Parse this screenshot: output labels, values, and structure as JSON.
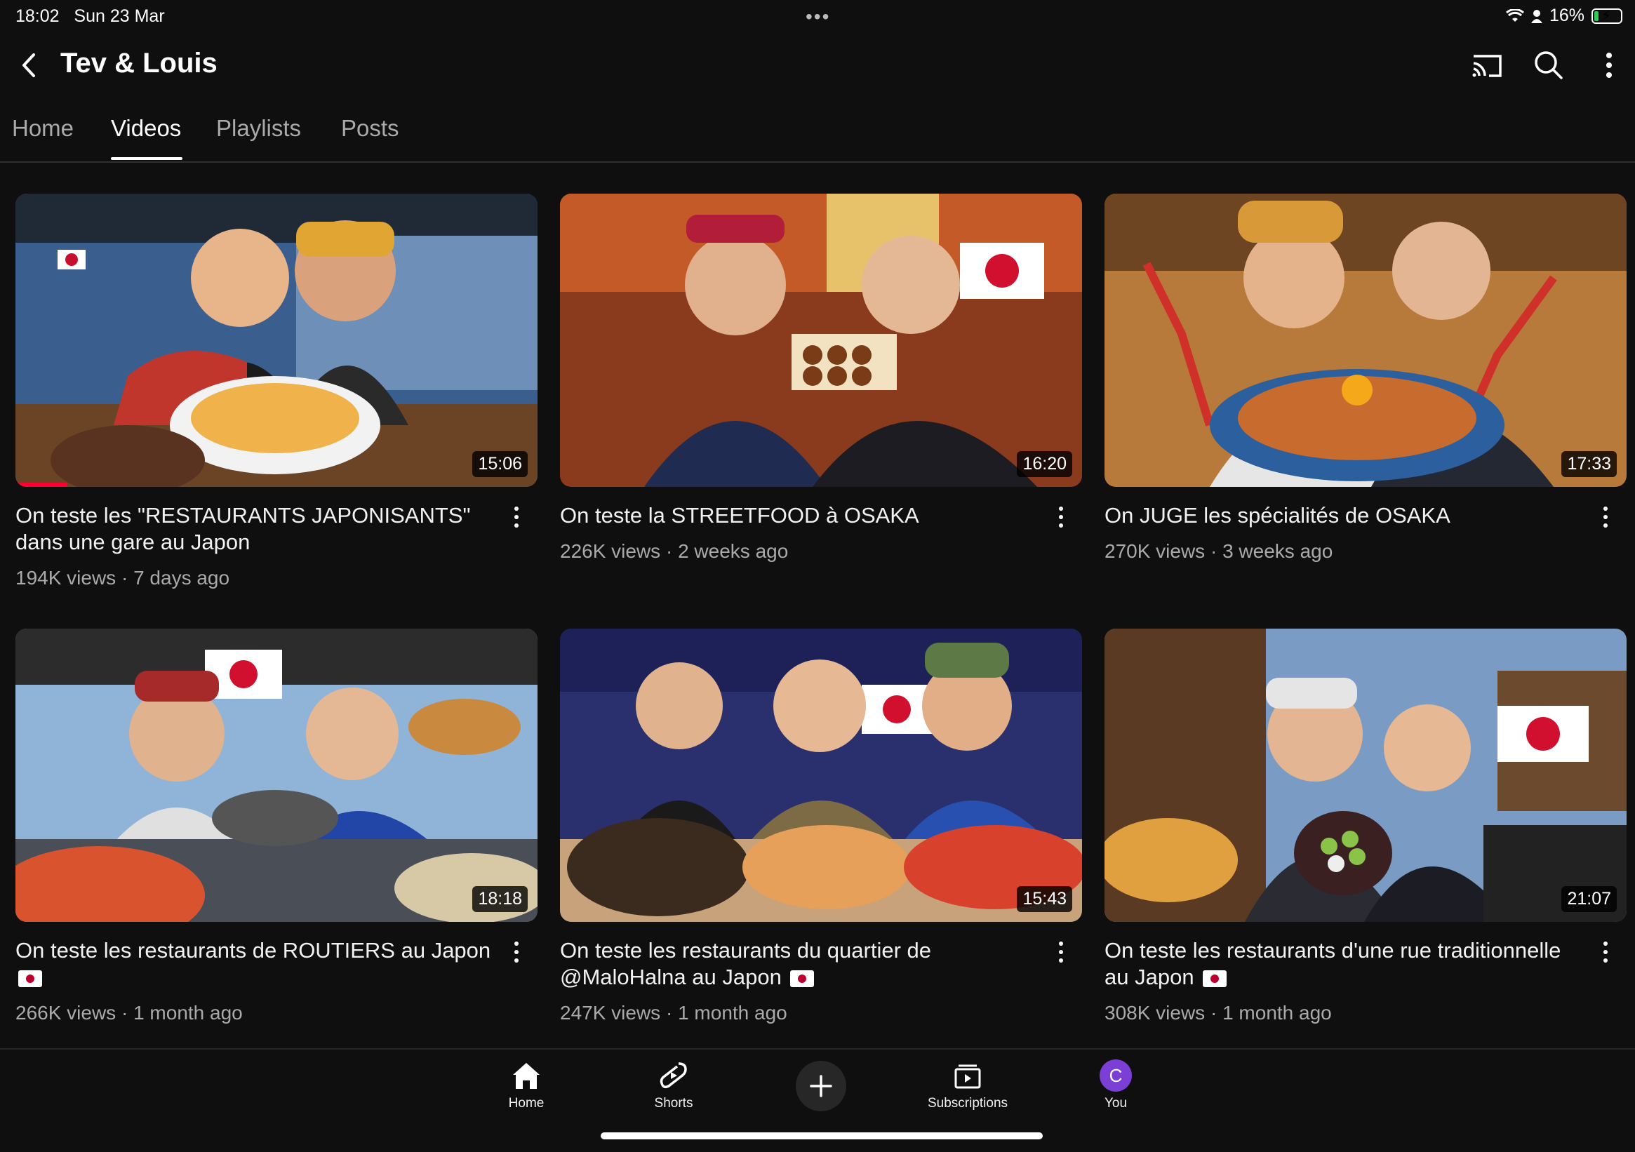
{
  "status": {
    "time": "18:02",
    "date": "Sun 23 Mar",
    "battery": "16%",
    "battery_level": 0.16
  },
  "header": {
    "title": "Tev & Louis",
    "icons": [
      "cast-icon",
      "search-icon",
      "more-vert-icon"
    ]
  },
  "tabs": [
    {
      "label": "Home",
      "active": false
    },
    {
      "label": "Videos",
      "active": true
    },
    {
      "label": "Playlists",
      "active": false
    },
    {
      "label": "Posts",
      "active": false
    }
  ],
  "videos": [
    {
      "title": "On teste les \"RESTAURANTS JAPONISANTS\" dans une gare au Japon",
      "views": "194K views · 7 days ago",
      "duration": "15:06",
      "watched_fraction": 0.1
    },
    {
      "title": "On teste la STREETFOOD à OSAKA",
      "views": "226K views · 2 weeks ago",
      "duration": "16:20"
    },
    {
      "title": "On JUGE les spécialités de OSAKA",
      "views": "270K views · 3 weeks ago",
      "duration": "17:33"
    },
    {
      "title": "On teste les restaurants de ROUTIERS au Japon",
      "views": "266K views · 1 month ago",
      "duration": "18:18",
      "flag": true
    },
    {
      "title": "On teste les restaurants du quartier de @MaloHalna au Japon",
      "views": "247K views · 1 month ago",
      "duration": "15:43",
      "flag": true
    },
    {
      "title": "On teste les restaurants d'une rue traditionnelle au Japon",
      "views": "308K views · 1 month ago",
      "duration": "21:07",
      "flag": true
    }
  ],
  "bottom_nav": [
    {
      "label": "Home",
      "icon": "home-icon"
    },
    {
      "label": "Shorts",
      "icon": "shorts-icon"
    },
    {
      "label": "",
      "icon": "create-plus-icon"
    },
    {
      "label": "Subscriptions",
      "icon": "subscriptions-icon"
    },
    {
      "label": "You",
      "icon": "avatar",
      "avatar_letter": "C"
    }
  ],
  "colors": {
    "background": "#0f0f0f",
    "accent_red": "#ff0033",
    "avatar": "#7b3fd6"
  }
}
